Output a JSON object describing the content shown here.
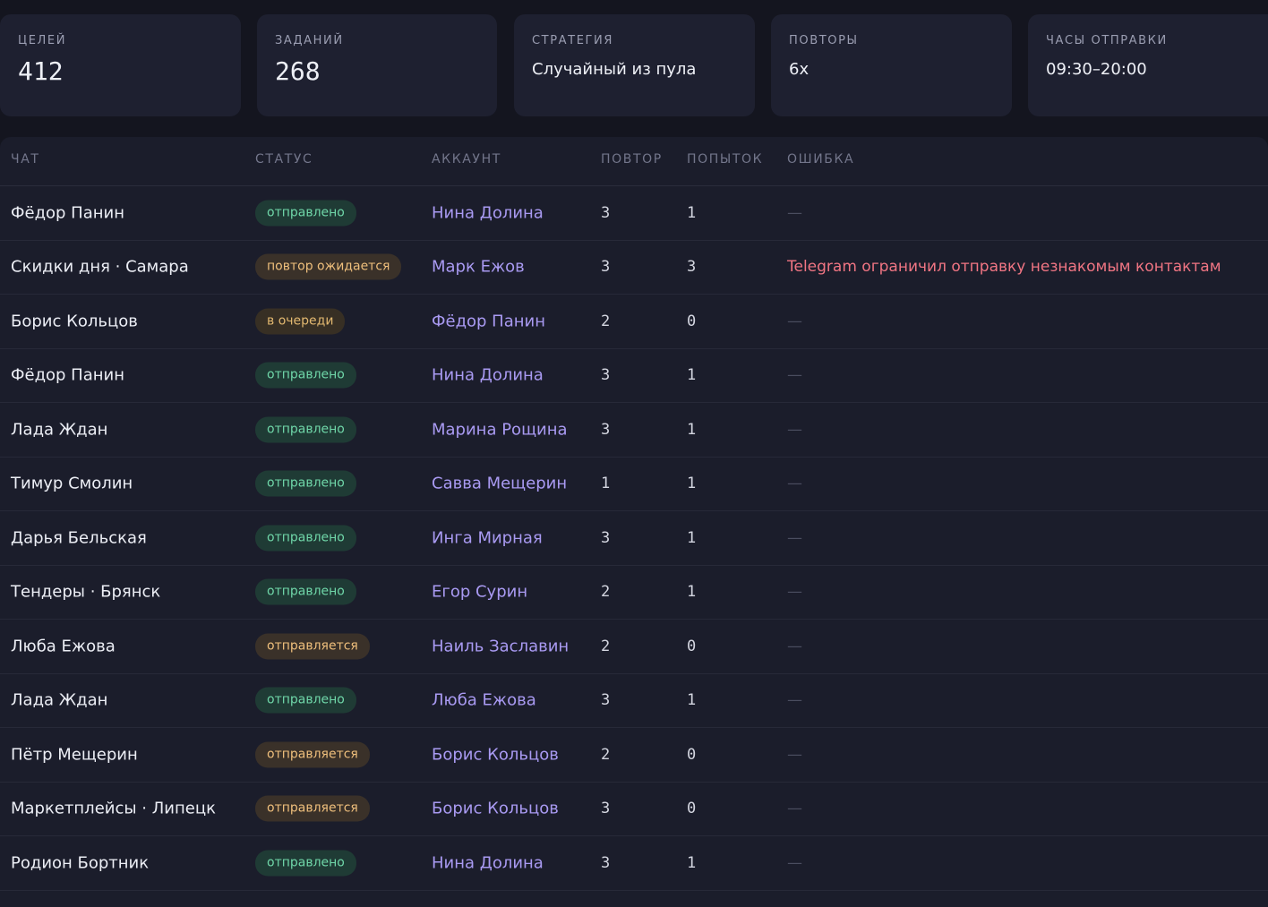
{
  "stats": [
    {
      "label": "ЦЕЛЕЙ",
      "value": "412",
      "mono": true
    },
    {
      "label": "ЗАДАНИЙ",
      "value": "268",
      "mono": true
    },
    {
      "label": "СТРАТЕГИЯ",
      "value": "Случайный из пула",
      "mono": false
    },
    {
      "label": "ПОВТОРЫ",
      "value": "6x",
      "mono": false
    },
    {
      "label": "ЧАСЫ ОТПРАВКИ",
      "value": "09:30–20:00",
      "mono": false
    }
  ],
  "table": {
    "columns": {
      "chat": "ЧАТ",
      "status": "СТАТУС",
      "account": "АККАУНТ",
      "repeat": "ПОВТОР",
      "attempts": "ПОПЫТОК",
      "error": "ОШИБКА"
    },
    "rows": [
      {
        "chat": "Фёдор Панин",
        "status": "отправлено",
        "status_kind": "sent",
        "account": "Нина Долина",
        "repeat": "3",
        "attempts": "1",
        "error": "—"
      },
      {
        "chat": "Скидки дня · Самара",
        "status": "повтор ожидается",
        "status_kind": "retry",
        "account": "Марк Ежов",
        "repeat": "3",
        "attempts": "3",
        "error": "Telegram ограничил отправку незнакомым контактам"
      },
      {
        "chat": "Борис Кольцов",
        "status": "в очереди",
        "status_kind": "queued",
        "account": "Фёдор Панин",
        "repeat": "2",
        "attempts": "0",
        "error": "—"
      },
      {
        "chat": "Фёдор Панин",
        "status": "отправлено",
        "status_kind": "sent",
        "account": "Нина Долина",
        "repeat": "3",
        "attempts": "1",
        "error": "—"
      },
      {
        "chat": "Лада Ждан",
        "status": "отправлено",
        "status_kind": "sent",
        "account": "Марина Рощина",
        "repeat": "3",
        "attempts": "1",
        "error": "—"
      },
      {
        "chat": "Тимур Смолин",
        "status": "отправлено",
        "status_kind": "sent",
        "account": "Савва Мещерин",
        "repeat": "1",
        "attempts": "1",
        "error": "—"
      },
      {
        "chat": "Дарья Бельская",
        "status": "отправлено",
        "status_kind": "sent",
        "account": "Инга Мирная",
        "repeat": "3",
        "attempts": "1",
        "error": "—"
      },
      {
        "chat": "Тендеры · Брянск",
        "status": "отправлено",
        "status_kind": "sent",
        "account": "Егор Сурин",
        "repeat": "2",
        "attempts": "1",
        "error": "—"
      },
      {
        "chat": "Люба Ежова",
        "status": "отправляется",
        "status_kind": "sending",
        "account": "Наиль Заславин",
        "repeat": "2",
        "attempts": "0",
        "error": "—"
      },
      {
        "chat": "Лада Ждан",
        "status": "отправлено",
        "status_kind": "sent",
        "account": "Люба Ежова",
        "repeat": "3",
        "attempts": "1",
        "error": "—"
      },
      {
        "chat": "Пётр Мещерин",
        "status": "отправляется",
        "status_kind": "sending",
        "account": "Борис Кольцов",
        "repeat": "2",
        "attempts": "0",
        "error": "—"
      },
      {
        "chat": "Маркетплейсы · Липецк",
        "status": "отправляется",
        "status_kind": "sending",
        "account": "Борис Кольцов",
        "repeat": "3",
        "attempts": "0",
        "error": "—"
      },
      {
        "chat": "Родион Бортник",
        "status": "отправлено",
        "status_kind": "sent",
        "account": "Нина Долина",
        "repeat": "3",
        "attempts": "1",
        "error": "—"
      }
    ]
  }
}
